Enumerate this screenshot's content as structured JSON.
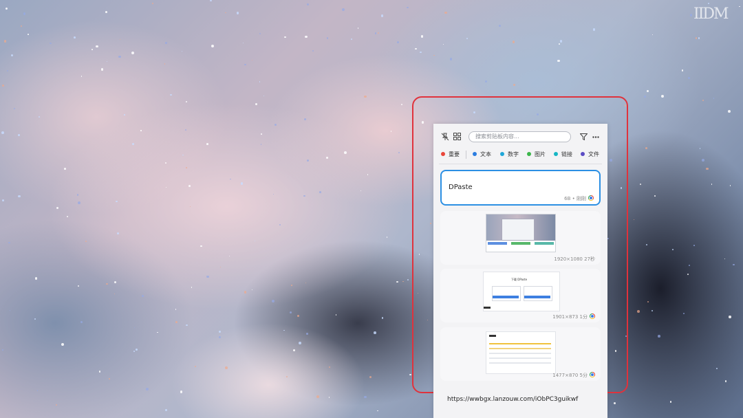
{
  "background": {
    "signature": "IIDM",
    "accent_frame_color": "#e0323c"
  },
  "toolbar": {
    "pin_icon": "unpin-icon",
    "grid_icon": "grid-icon",
    "search_placeholder": "搜索剪贴板内容...",
    "filter_icon": "filter-icon",
    "more_icon": "more-icon"
  },
  "filters": [
    {
      "label": "重要",
      "color": "#e9463a"
    },
    {
      "label": "文本",
      "color": "#2b7de0"
    },
    {
      "label": "数字",
      "color": "#20a7d8"
    },
    {
      "label": "图片",
      "color": "#3bb54a"
    },
    {
      "label": "链接",
      "color": "#16b6c4"
    },
    {
      "label": "文件",
      "color": "#5b4cc4"
    }
  ],
  "clips": [
    {
      "type": "text",
      "content": "DPaste",
      "meta": "6B • 刚刚",
      "selected": true,
      "source_icon": "chrome-icon"
    },
    {
      "type": "image",
      "meta": "1920×1080 27秒",
      "selected": false,
      "source_icon": ""
    },
    {
      "type": "image",
      "meta": "1901×873 1分",
      "selected": false,
      "source_icon": "chrome-icon",
      "thumb_title": "下载 DPaste"
    },
    {
      "type": "image",
      "meta": "1477×870 5分",
      "selected": false,
      "source_icon": "chrome-icon"
    }
  ],
  "link_clip": {
    "content": "https://wwbgx.lanzouw.com/iObPC3guikwf"
  }
}
